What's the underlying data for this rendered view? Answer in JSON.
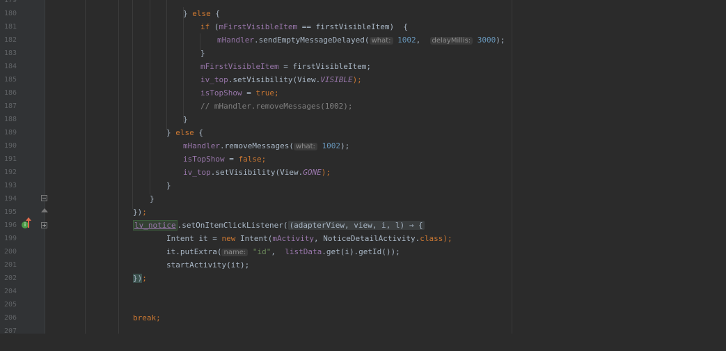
{
  "editor": {
    "lines": [
      {
        "num": "179"
      },
      {
        "num": "180"
      },
      {
        "num": "181"
      },
      {
        "num": "182"
      },
      {
        "num": "183"
      },
      {
        "num": "184"
      },
      {
        "num": "185"
      },
      {
        "num": "186"
      },
      {
        "num": "187"
      },
      {
        "num": "188"
      },
      {
        "num": "189"
      },
      {
        "num": "190"
      },
      {
        "num": "191"
      },
      {
        "num": "192"
      },
      {
        "num": "193"
      },
      {
        "num": "194"
      },
      {
        "num": "195"
      },
      {
        "num": "196"
      },
      {
        "num": "199"
      },
      {
        "num": "200"
      },
      {
        "num": "201"
      },
      {
        "num": "202"
      },
      {
        "num": "204"
      },
      {
        "num": "205"
      },
      {
        "num": "206"
      },
      {
        "num": "207"
      }
    ],
    "code": {
      "l180_close": "} ",
      "l180_else": "else",
      "l180_open": " {",
      "l181_if": "if",
      "l181_paren": " (",
      "l181_field": "mFirstVisibleItem",
      "l181_rest": " == firstVisibleItem)  {",
      "l182_field": "mHandler",
      "l182_call": ".sendEmptyMessageDelayed(",
      "l182_hint1": "what:",
      "l182_num1": " 1002",
      "l182_comma": ",  ",
      "l182_hint2": "delayMillis:",
      "l182_num2": " 3000",
      "l182_end": ");",
      "l183": "}",
      "l184_field": "mFirstVisibleItem",
      "l184_rest": " = firstVisibleItem;",
      "l185_field": "iv_top",
      "l185_call": ".setVisibility(View.",
      "l185_const": "VISIBLE",
      "l185_end": ");",
      "l186_field": "isTopShow",
      "l186_eq": " = ",
      "l186_kw": "true",
      "l186_semi": ";",
      "l187_comment": "// mHandler.removeMessages(1002);",
      "l188": "}",
      "l189_close": "} ",
      "l189_else": "else",
      "l189_open": " {",
      "l190_field": "mHandler",
      "l190_call": ".removeMessages(",
      "l190_hint": "what:",
      "l190_num": " 1002",
      "l190_end": ");",
      "l191_field": "isTopShow",
      "l191_eq": " = ",
      "l191_kw": "false",
      "l191_semi": ";",
      "l192_field": "iv_top",
      "l192_call": ".setVisibility(View.",
      "l192_const": "GONE",
      "l192_end": ");",
      "l193": "}",
      "l194": "}",
      "l195_brace": "})",
      "l195_semi": ";",
      "l196_ident": "lv_notice",
      "l196_call": ".setOnItemClickListener(",
      "l196_folded": "(adapterView, view, i, l) → {",
      "l199_text": "Intent it = ",
      "l199_new": "new",
      "l199_mid": " Intent(",
      "l199_field": "mActivity",
      "l199_mid2": ", NoticeDetailActivity.",
      "l199_class": "class",
      "l199_end": ");",
      "l200_call": "it.putExtra(",
      "l200_hint": "name:",
      "l200_str": " \"id\"",
      "l200_comma": ",  ",
      "l200_field": "listData",
      "l200_rest": ".get(i).getId());",
      "l201": "startActivity(it);",
      "l202_brace": "})",
      "l202_semi": ";",
      "l206_kw": "break",
      "l206_semi": ";"
    }
  },
  "colors": {
    "background": "#2b2b2b",
    "gutter": "#313335",
    "keyword": "#cc7832",
    "field": "#9876aa",
    "number": "#6897bb",
    "string": "#6a8759",
    "comment": "#808080"
  },
  "icons": [
    "implementation-icon",
    "override-arrow-icon",
    "fold-icon"
  ]
}
